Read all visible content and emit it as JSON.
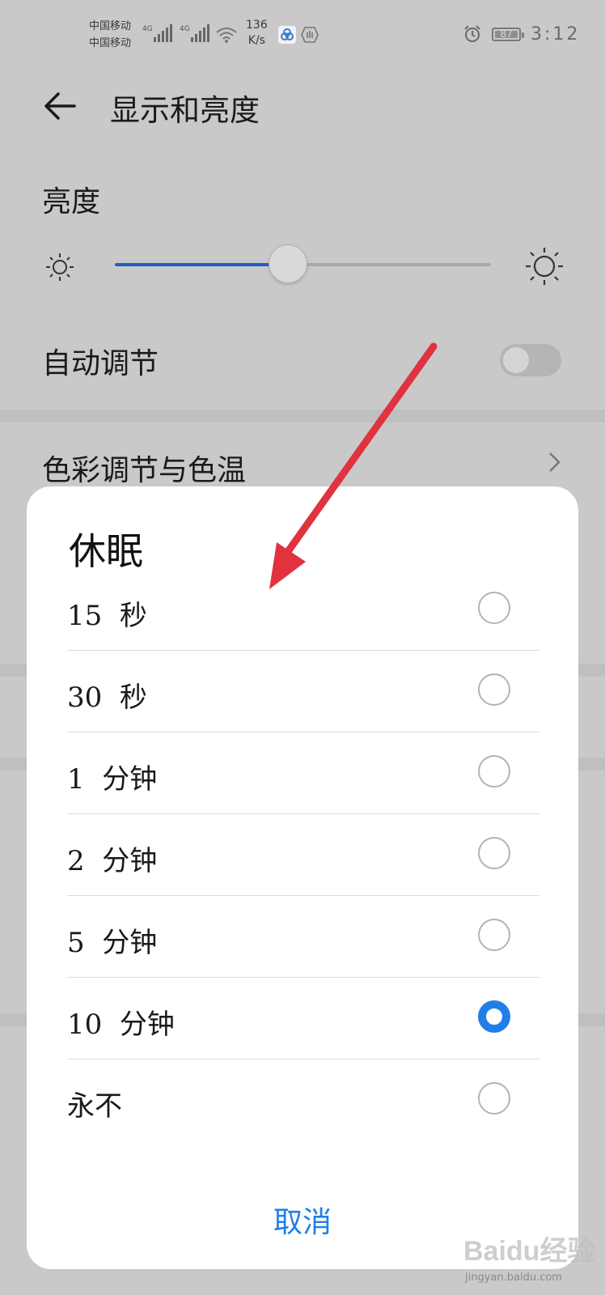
{
  "status": {
    "carrier1": "中国移动",
    "carrier2": "中国移动",
    "sig1": "4G",
    "sig2": "4G",
    "speed_value": "136",
    "speed_unit": "K/s",
    "battery": "87",
    "time": "3:12"
  },
  "header": {
    "title": "显示和亮度"
  },
  "brightness": {
    "label": "亮度",
    "level": 0.46
  },
  "auto_adjust": {
    "label": "自动调节",
    "enabled": false
  },
  "color_temp": {
    "label": "色彩调节与色温"
  },
  "dialog": {
    "title": "休眠",
    "options": [
      {
        "label": "15  秒",
        "selected": false
      },
      {
        "label": "30  秒",
        "selected": false
      },
      {
        "label": "1  分钟",
        "selected": false
      },
      {
        "label": "2  分钟",
        "selected": false
      },
      {
        "label": "5  分钟",
        "selected": false
      },
      {
        "label": "10  分钟",
        "selected": true
      },
      {
        "label": "永不",
        "selected": false
      }
    ],
    "cancel": "取消"
  },
  "watermark": {
    "brand": "Baidu经验",
    "site": "jingyan.baidu.com"
  },
  "colors": {
    "accent": "#1f7ee8",
    "arrow": "#e0333f"
  }
}
